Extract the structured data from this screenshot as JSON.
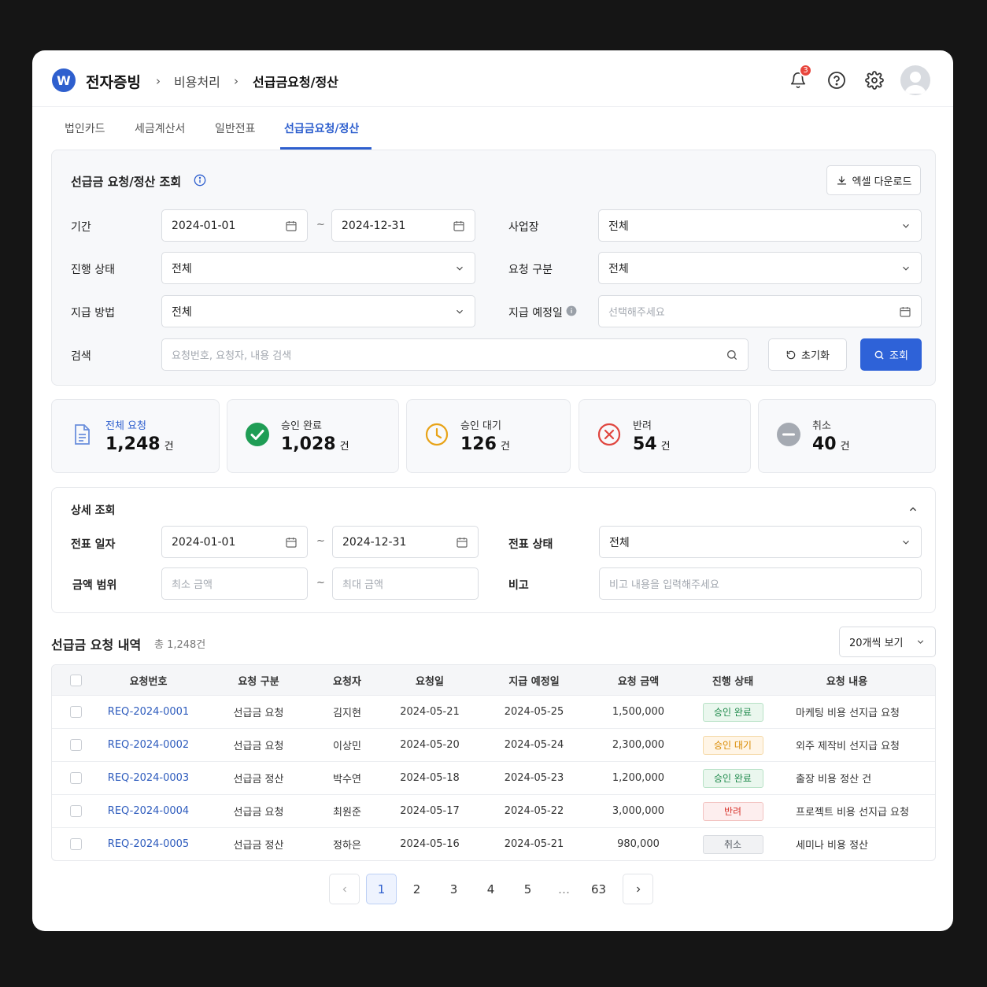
{
  "header": {
    "logo_letter": "W",
    "app_name": "전자증빙",
    "breadcrumb_mid": "비용처리",
    "breadcrumb_current": "선급금요청/정산",
    "notification_count": "3"
  },
  "tabs": [
    {
      "label": "법인카드",
      "active": false
    },
    {
      "label": "세금계산서",
      "active": false
    },
    {
      "label": "일반전표",
      "active": false
    },
    {
      "label": "선급금요청/정산",
      "active": true
    }
  ],
  "search": {
    "title": "선급금 요청/정산 조회",
    "excel_button": "엑셀 다운로드",
    "period_label": "기간",
    "period_start": "2024-01-01",
    "period_end": "2024-12-31",
    "site_label": "사업장",
    "site_value": "전체",
    "progress_label": "진행 상태",
    "progress_value": "전체",
    "request_type_label": "요청 구분",
    "request_type_value": "전체",
    "pay_method_label": "지급 방법",
    "pay_method_value": "전체",
    "pay_date_label": "지급 예정일",
    "pay_date_placeholder": "선택해주세요",
    "keyword_label": "검색",
    "keyword_placeholder": "요청번호, 요청자, 내용 검색",
    "reset_button": "초기화",
    "search_button": "조회"
  },
  "stats": [
    {
      "label": "전체 요청",
      "value": "1,248",
      "unit": "건",
      "icon": "document-icon",
      "color": "#2e5fce"
    },
    {
      "label": "승인 완료",
      "value": "1,028",
      "unit": "건",
      "icon": "check-circle-icon",
      "color": "#1f9d55"
    },
    {
      "label": "승인 대기",
      "value": "126",
      "unit": "건",
      "icon": "clock-icon",
      "color": "#e8a317"
    },
    {
      "label": "반려",
      "value": "54",
      "unit": "건",
      "icon": "x-circle-icon",
      "color": "#e0463f"
    },
    {
      "label": "취소",
      "value": "40",
      "unit": "건",
      "icon": "minus-circle-icon",
      "color": "#9aa0a8"
    }
  ],
  "detail": {
    "title": "상세 조회",
    "doc_date_label": "전표 일자",
    "doc_date_start": "2024-01-01",
    "doc_date_end": "2024-12-31",
    "doc_status_label": "전표 상태",
    "doc_status_value": "전체",
    "amount_label": "금액 범위",
    "amount_min_placeholder": "최소 금액",
    "amount_max_placeholder": "최대 금액",
    "note_label": "비고",
    "note_placeholder": "비고 내용을 입력해주세요"
  },
  "list": {
    "title": "선급금 요청 내역",
    "total": "총 1,248건",
    "page_size": "20개씩 보기",
    "columns": [
      "요청번호",
      "요청 구분",
      "요청자",
      "요청일",
      "지급 예정일",
      "요청 금액",
      "진행 상태",
      "요청 내용"
    ],
    "rows": [
      {
        "no": "REQ-2024-0001",
        "type": "선급금 요청",
        "requester": "김지현",
        "date": "2024-05-21",
        "pay_date": "2024-05-25",
        "amount": "1,500,000",
        "status": "승인 완료",
        "status_kind": "approved",
        "content": "마케팅 비용 선지급 요청"
      },
      {
        "no": "REQ-2024-0002",
        "type": "선급금 요청",
        "requester": "이상민",
        "date": "2024-05-20",
        "pay_date": "2024-05-24",
        "amount": "2,300,000",
        "status": "승인 대기",
        "status_kind": "pending",
        "content": "외주 제작비 선지급 요청"
      },
      {
        "no": "REQ-2024-0003",
        "type": "선급금 정산",
        "requester": "박수연",
        "date": "2024-05-18",
        "pay_date": "2024-05-23",
        "amount": "1,200,000",
        "status": "승인 완료",
        "status_kind": "approved",
        "content": "출장 비용 정산 건"
      },
      {
        "no": "REQ-2024-0004",
        "type": "선급금 요청",
        "requester": "최원준",
        "date": "2024-05-17",
        "pay_date": "2024-05-22",
        "amount": "3,000,000",
        "status": "반려",
        "status_kind": "rejected",
        "content": "프로젝트 비용 선지급 요청"
      },
      {
        "no": "REQ-2024-0005",
        "type": "선급금 정산",
        "requester": "정하은",
        "date": "2024-05-16",
        "pay_date": "2024-05-21",
        "amount": "980,000",
        "status": "취소",
        "status_kind": "cancelled",
        "content": "세미나 비용 정산"
      }
    ],
    "status_colors": {
      "approved": {
        "bg": "#eaf7ee",
        "fg": "#1f8a4c",
        "border": "#b8e2c6"
      },
      "pending": {
        "bg": "#fff5e6",
        "fg": "#d98a00",
        "border": "#f5d9a8"
      },
      "rejected": {
        "bg": "#fdeeee",
        "fg": "#d93a33",
        "border": "#f3c3c1"
      },
      "cancelled": {
        "bg": "#f1f2f4",
        "fg": "#555b63",
        "border": "#d9dce1"
      }
    }
  },
  "pagination": {
    "pages": [
      "1",
      "2",
      "3",
      "4",
      "5"
    ],
    "current": "1",
    "ellipsis": "…",
    "last": "63"
  }
}
